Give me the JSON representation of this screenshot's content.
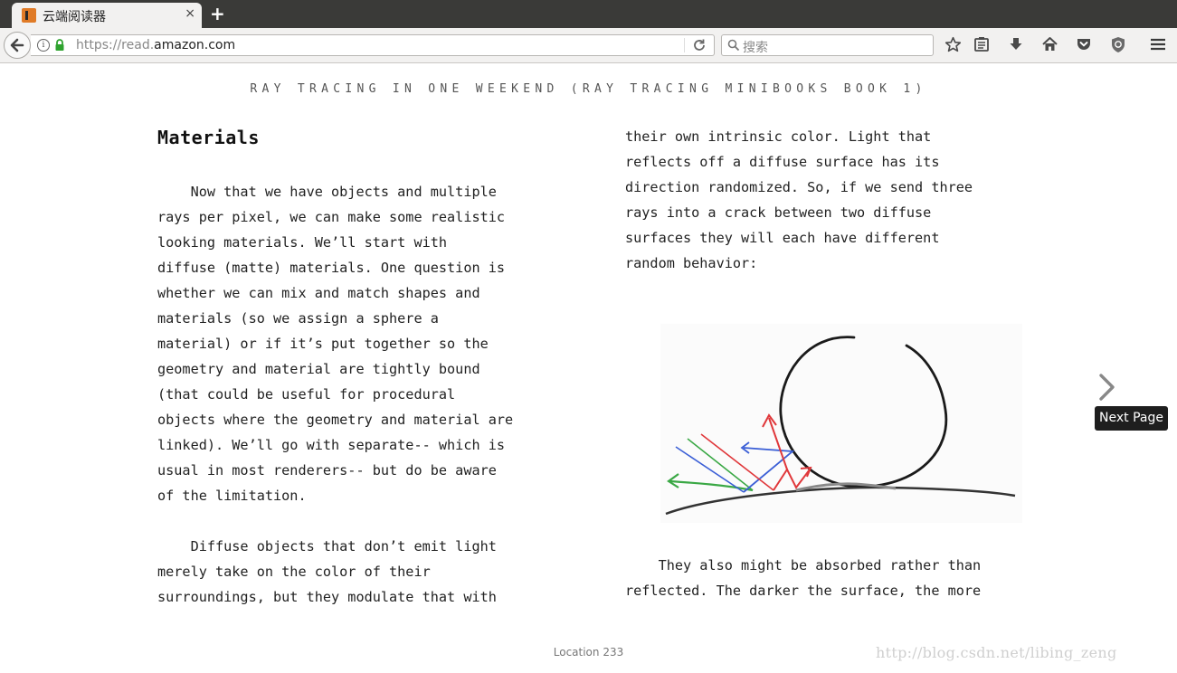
{
  "browser": {
    "tab_title": "云端阅读器",
    "tab_close": "×",
    "new_tab": "+",
    "url_prefix": "https://read.",
    "url_host": "amazon.com",
    "search_placeholder": "搜索"
  },
  "reader": {
    "book_title": "RAY TRACING IN ONE WEEKEND (RAY TRACING MINIBOOKS BOOK 1)",
    "section_heading": "Materials",
    "left_lines": [
      "    Now that we have objects and multiple",
      "rays per pixel, we can make some realistic",
      "looking materials. We’ll start with",
      "diffuse (matte) materials. One question is",
      "whether we can mix and match shapes and",
      "materials (so we assign a sphere a",
      "material) or if it’s put together so the",
      "geometry and material are tightly bound",
      "(that could be useful for procedural",
      "objects where the geometry and material are",
      "linked). We’ll go with separate-- which is",
      "usual in most renderers-- but do be aware",
      "of the limitation.",
      "",
      "    Diffuse objects that don’t emit light",
      "merely take on the color of their",
      "surroundings, but they modulate that with"
    ],
    "right_lines_top": [
      "their own intrinsic color. Light that",
      "reflects off a diffuse surface has its",
      "direction randomized. So, if we send three",
      "rays into a crack between two diffuse",
      "surfaces they will each have different",
      "random behavior:"
    ],
    "right_lines_bottom": [
      "    They also might be absorbed rather than",
      "reflected. The darker the surface, the more"
    ],
    "next_page_tooltip": "Next Page",
    "location": "Location 233"
  },
  "watermark": "http://blog.csdn.net/libing_zeng",
  "colors": {
    "tab_strip": "#3a3a38",
    "toolbar": "#f2f1f0",
    "ray_red": "#e0373a",
    "ray_blue": "#3b5fd6",
    "ray_green": "#3aa845",
    "lock_green": "#2fa32f"
  },
  "icons": [
    "back-arrow-icon",
    "info-icon",
    "lock-icon",
    "reload-icon",
    "search-icon",
    "star-icon",
    "reading-list-icon",
    "download-icon",
    "home-icon",
    "pocket-icon",
    "shield-icon",
    "menu-icon",
    "chevron-right-icon"
  ]
}
